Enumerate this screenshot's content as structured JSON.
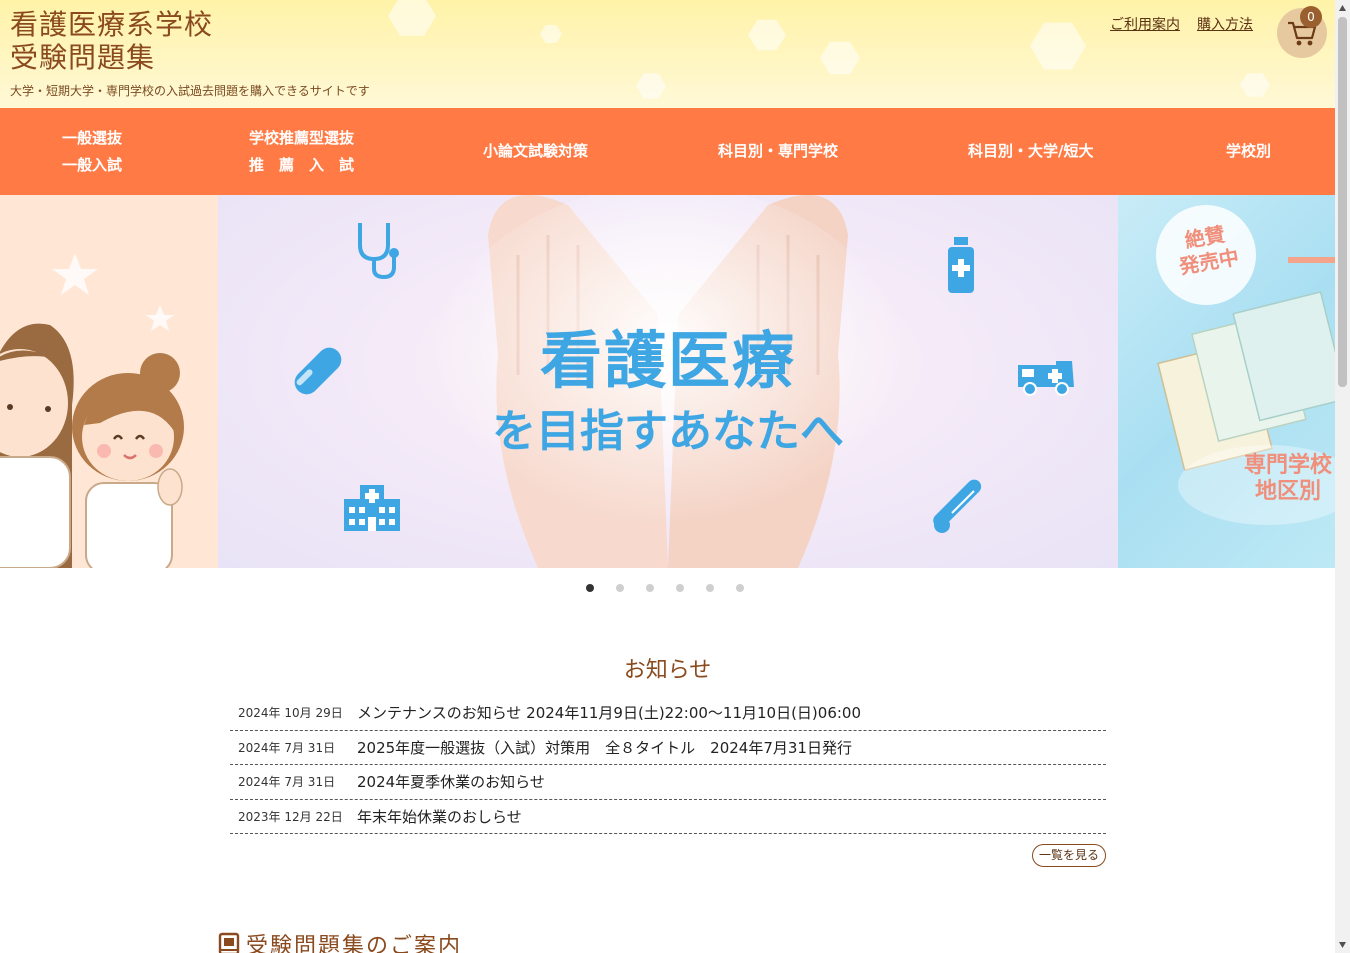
{
  "header": {
    "title_line1": "看護医療系学校",
    "title_line2": "受験問題集",
    "tagline": "大学・短期大学・専門学校の入試過去問題を購入できるサイトです",
    "links": [
      "ご利用案内",
      "購入方法"
    ],
    "cart_count": "0",
    "cart_icon": "cart-icon"
  },
  "nav": {
    "items": [
      {
        "line1": "一般選抜",
        "line2": "一般入試"
      },
      {
        "line1": "学校推薦型選抜",
        "line2": "推　薦　入　試"
      },
      {
        "line1": "小論文試験対策",
        "line2": ""
      },
      {
        "line1": "科目別・専門学校",
        "line2": ""
      },
      {
        "line1": "科目別・大学/短大",
        "line2": ""
      },
      {
        "line1": "学校別",
        "line2": ""
      }
    ]
  },
  "hero": {
    "headline": "看護医療",
    "subline": "を目指すあなたへ",
    "right_badge_line1": "絶賛",
    "right_badge_line2": "発売中",
    "right_caption_line1": "専門学校",
    "right_caption_line2": "地区別",
    "slide_count": 6,
    "active_slide": 1
  },
  "news": {
    "title": "お知らせ",
    "items": [
      {
        "date": "2024年 10月 29日",
        "text": "メンテナンスのお知らせ 2024年11月9日(土)22:00〜11月10日(日)06:00"
      },
      {
        "date": "2024年 7月 31日",
        "text": "2025年度一般選抜（入試）対策用　全８タイトル　2024年7月31日発行"
      },
      {
        "date": "2024年 7月 31日",
        "text": "2024年夏季休業のお知らせ"
      },
      {
        "date": "2023年 12月 22日",
        "text": "年末年始休業のおしらせ"
      }
    ],
    "more_label": "一覧を見る"
  },
  "guide": {
    "title": "受験問題集のご案内",
    "icon": "book-icon"
  },
  "colors": {
    "nav_bg": "#ff7a45",
    "brand_brown": "#8a4a1e",
    "hero_blue": "#3fa6e4"
  }
}
